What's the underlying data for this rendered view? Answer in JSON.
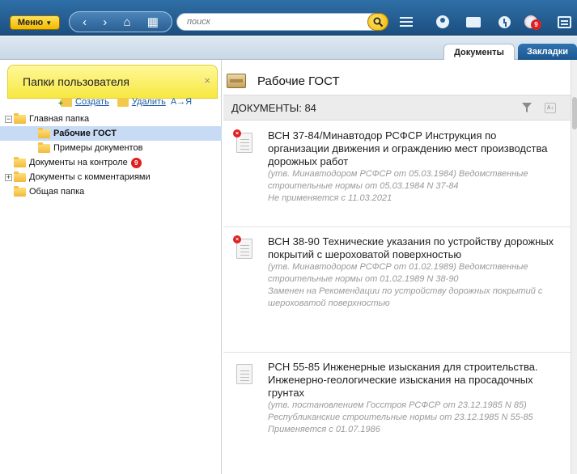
{
  "toolbar": {
    "menu_label": "Меню",
    "search_placeholder": "поиск",
    "timer_badge": "9"
  },
  "tabs": [
    {
      "label": "Документы",
      "active": true
    },
    {
      "label": "Закладки",
      "active": false
    }
  ],
  "left_panel": {
    "title": "Папки пользователя",
    "close_symbol": "×",
    "actions": {
      "create_label": "Создать",
      "delete_label": "Удалить",
      "sort_label": "А→Я"
    },
    "tree": [
      {
        "label": "Главная папка",
        "expander": "−",
        "level": 0
      },
      {
        "label": "Рабочие ГОСТ",
        "level": 1,
        "selected": true
      },
      {
        "label": "Примеры документов",
        "level": 1
      },
      {
        "label": "Документы на контроле",
        "level": 0,
        "badge": "9"
      },
      {
        "label": "Документы с комментариями",
        "expander": "+",
        "level": 0
      },
      {
        "label": "Общая папка",
        "level": 0
      }
    ]
  },
  "right_panel": {
    "folder_title": "Рабочие ГОСТ",
    "count_label": "ДОКУМЕНТЫ: 84",
    "documents": [
      {
        "name": "ВСН 37-84/Минавтодор РСФСР Инструкция по организации движения и ограждению мест производства дорожных работ",
        "meta": "(утв. Минавтодором РСФСР от 05.03.1984) Ведомственные строительные нормы от 05.03.1984 N 37-84",
        "status": "Не применяется с 11.03.2021",
        "invalid": true
      },
      {
        "name": "ВСН 38-90 Технические указания по устройству дорожных покрытий с шероховатой поверхностью",
        "meta": "(утв. Минавтодором РСФСР от 01.02.1989) Ведомственные строительные нормы от 01.02.1989 N 38-90",
        "status": "Заменен на Рекомендации по устройству дорожных покрытий с шероховатой поверхностью",
        "invalid": true
      },
      {
        "name": "РСН 55-85 Инженерные изыскания для строительства. Инженерно-геологические изыскания на просадочных грунтах",
        "meta": "(утв. постановлением Госстроя РСФСР от 23.12.1985 N 85) Республиканские строительные нормы от 23.12.1985 N 55-85",
        "status": "Применяется с 01.07.1986",
        "invalid": false
      }
    ]
  },
  "colors": {
    "toolbar_blue": "#2a5f93",
    "menu_yellow": "#f2b800",
    "panel_header_yellow": "#f7e840",
    "selected_row": "#c7dbf5",
    "badge_red": "#e02020",
    "link_blue": "#1a5ba8"
  },
  "icons": [
    "back-arrow-icon",
    "forward-arrow-icon",
    "home-icon",
    "grid-icon",
    "search-icon",
    "hamburger-icon",
    "user-icon",
    "folder-icon",
    "clock-icon",
    "timer-icon",
    "message-icon",
    "filter-icon",
    "sort-az-icon",
    "document-icon",
    "folder-tree-icon"
  ]
}
